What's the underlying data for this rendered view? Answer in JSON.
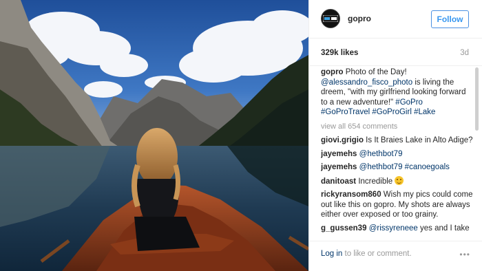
{
  "post": {
    "photo_alt": "Woman in a wooden rowboat on a mountain lake",
    "username": "gopro",
    "follow_label": "Follow",
    "likes": "329k likes",
    "time": "3d",
    "caption": {
      "user": "gopro",
      "text_1": " Photo of the Day! ",
      "mention": "@alessandro_fisco_photo",
      "text_2": " is living the dreem, \"with my girlfriend looking forward to a new adventure!\" ",
      "hashtags": "#GoPro #GoProTravel #GoProGirl #Lake"
    },
    "view_all": "view all 654 comments",
    "comments": [
      {
        "user": "giovi.grigio",
        "pre": " Is It Braies Lake in Alto Adige?",
        "mention": "",
        "post": ""
      },
      {
        "user": "jayemehs",
        "pre": " ",
        "mention": "@hethbot79",
        "post": ""
      },
      {
        "user": "jayemehs",
        "pre": " ",
        "mention": "@hethbot79 #canoegoals",
        "post": ""
      },
      {
        "user": "danitoast",
        "pre": " Incredible ",
        "mention": "",
        "post": ""
      },
      {
        "user": "rickyransom860",
        "pre": " Wish my pics could come out like this on gopro. My shots are always either over exposed or too grainy.",
        "mention": "",
        "post": ""
      },
      {
        "user": "g_gussen39",
        "pre": " ",
        "mention": "@rissyreneee",
        "post": " yes and I take"
      }
    ],
    "login_link": "Log in",
    "login_rest": " to like or comment.",
    "more_label": "•••"
  },
  "icons": {
    "avatar": "gopro-logo-icon",
    "emoji": "smiling-face-icon",
    "more": "more-options-icon"
  },
  "colors": {
    "follow_blue": "#3897f0",
    "link_blue": "#003569",
    "muted": "#999999"
  }
}
